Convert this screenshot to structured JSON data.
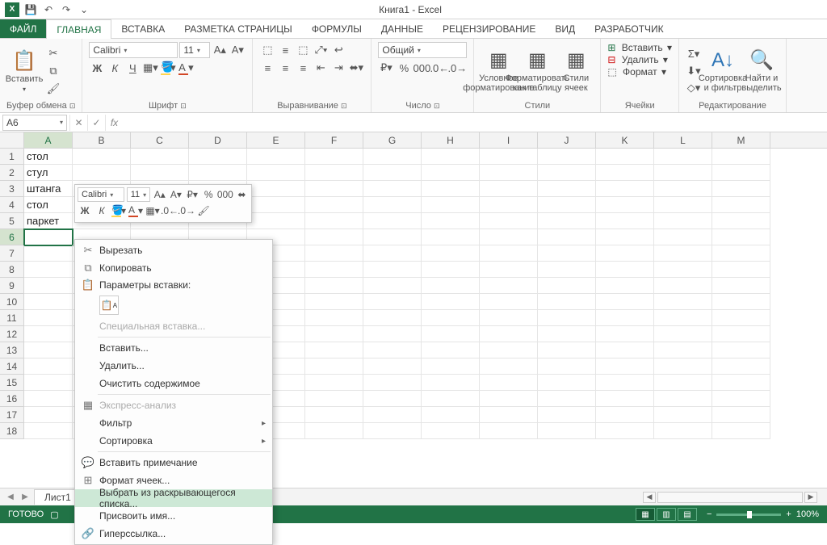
{
  "app": {
    "title": "Книга1 - Excel",
    "logo": "X"
  },
  "qat": {
    "save_tip": "💾",
    "undo_tip": "↶",
    "redo_tip": "↷",
    "touch_tip": "⌄"
  },
  "tabs": {
    "file": "ФАЙЛ",
    "items": [
      "ГЛАВНАЯ",
      "ВСТАВКА",
      "РАЗМЕТКА СТРАНИЦЫ",
      "ФОРМУЛЫ",
      "ДАННЫЕ",
      "РЕЦЕНЗИРОВАНИЕ",
      "ВИД",
      "РАЗРАБОТЧИК"
    ],
    "active_index": 0
  },
  "ribbon": {
    "clipboard": {
      "paste": "Вставить",
      "group": "Буфер обмена"
    },
    "font": {
      "name": "Calibri",
      "size": "11",
      "group": "Шрифт",
      "bold": "Ж",
      "italic": "К",
      "underline": "Ч"
    },
    "align": {
      "group": "Выравнивание"
    },
    "number": {
      "format": "Общий",
      "group": "Число"
    },
    "styles": {
      "cond": "Условное форматирование",
      "table": "Форматировать как таблицу",
      "cell": "Стили ячеек",
      "group": "Стили"
    },
    "cells": {
      "insert": "Вставить",
      "delete": "Удалить",
      "format": "Формат",
      "group": "Ячейки"
    },
    "editing": {
      "sort": "Сортировка и фильтр",
      "find": "Найти и выделить",
      "group": "Редактирование"
    }
  },
  "formula_bar": {
    "name_box": "A6",
    "fx": "fx"
  },
  "grid": {
    "cols": [
      "A",
      "B",
      "C",
      "D",
      "E",
      "F",
      "G",
      "H",
      "I",
      "J",
      "K",
      "L",
      "M"
    ],
    "rows": [
      1,
      2,
      3,
      4,
      5,
      6,
      7,
      8,
      9,
      10,
      11,
      12,
      13,
      14,
      15,
      16,
      17,
      18
    ],
    "active": {
      "row": 6,
      "col": 0
    },
    "data": {
      "A1": "стол",
      "A2": "стул",
      "A3": "штанга",
      "A4": "стол",
      "A5": "паркет"
    }
  },
  "mini_toolbar": {
    "font": "Calibri",
    "size": "11"
  },
  "context_menu": {
    "cut": "Вырезать",
    "copy": "Копировать",
    "paste_section": "Параметры вставки:",
    "paste_special": "Специальная вставка...",
    "insert": "Вставить...",
    "delete": "Удалить...",
    "clear": "Очистить содержимое",
    "quick": "Экспресс-анализ",
    "filter": "Фильтр",
    "sort": "Сортировка",
    "comment": "Вставить примечание",
    "format_cells": "Формат ячеек...",
    "pick_list": "Выбрать из раскрывающегося списка...",
    "define_name": "Присвоить имя...",
    "hyperlink": "Гиперссылка..."
  },
  "sheets": {
    "active": "Лист1"
  },
  "status": {
    "ready": "ГОТОВО",
    "zoom": "100%"
  }
}
